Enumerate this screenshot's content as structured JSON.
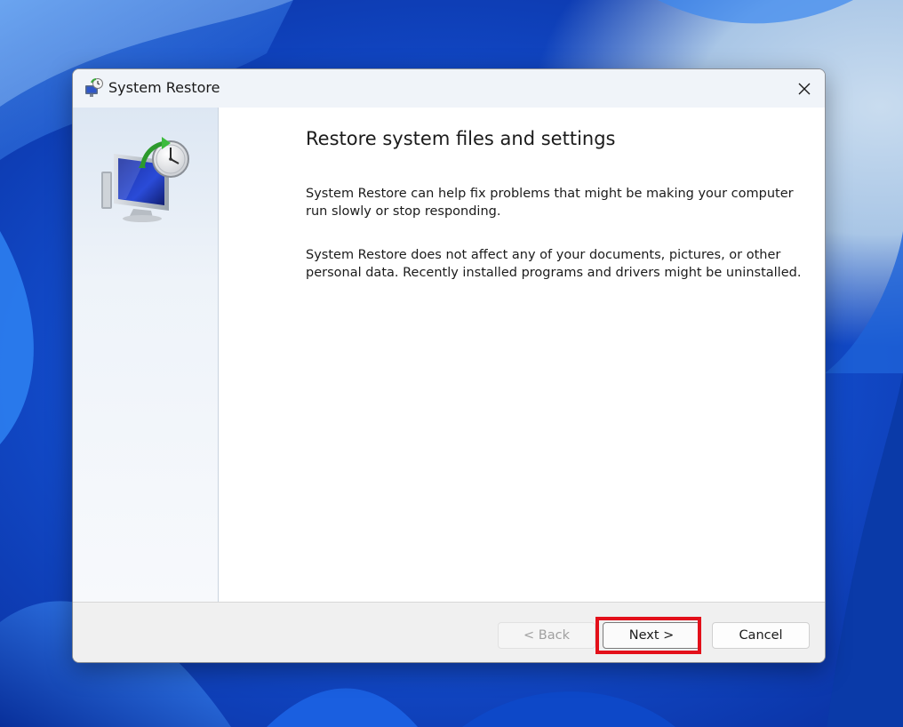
{
  "window": {
    "title": "System Restore",
    "icons": {
      "app": "system-restore-icon",
      "close": "close-icon",
      "hero": "system-restore-computer-clock-icon"
    }
  },
  "content": {
    "heading": "Restore system files and settings",
    "paragraph1": "System Restore can help fix problems that might be making your computer run slowly or stop responding.",
    "paragraph2": "System Restore does not affect any of your documents, pictures, or other personal data. Recently installed programs and drivers might be uninstalled."
  },
  "footer": {
    "back_label": "< Back",
    "back_enabled": false,
    "next_label": "Next >",
    "cancel_label": "Cancel"
  },
  "colors": {
    "highlight": "#e3101a",
    "desktop_blue": "#1553d6",
    "titlebar_bg": "#f0f4f9"
  }
}
